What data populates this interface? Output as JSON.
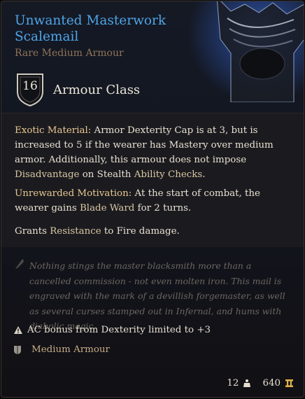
{
  "item": {
    "name": "Unwanted Masterwork Scalemail",
    "rarity_type": "Rare Medium Armour",
    "armour_class": "16",
    "armour_class_label": "Armour Class"
  },
  "effects": {
    "exotic_title": "Exotic Material:",
    "exotic_text_1": " Armor Dexterity Cap is at 3, but is increased to 5 if the wearer has Mastery over medium armor. Additionally, this armour does not impose ",
    "exotic_kw_disadvantage": "Disadvantage",
    "exotic_text_2": " on Stealth ",
    "exotic_kw_ability_checks": "Ability Checks",
    "exotic_text_3": ".",
    "motivation_title": "Unrewarded Motivation:",
    "motivation_text_1": " At the start of combat, the wearer gains ",
    "motivation_kw": "Blade Ward",
    "motivation_text_2": " for 2 turns.",
    "grants_text_1": "Grants ",
    "grants_kw": "Resistance",
    "grants_text_2": " to Fire damage."
  },
  "flavor_text": "Nothing stings the master blacksmith more than a cancelled commission - not even molten iron. This mail is engraved with the mark of a devillish forgemaster, as well as several curses stamped out in Infernal, and hums with diabolic magic.",
  "notes": {
    "dex_limit": "AC bonus from Dexterity limited to +3",
    "armour_type": "Medium Armour"
  },
  "footer": {
    "weight": "12",
    "price": "640"
  },
  "icons": [
    "shield-icon",
    "quill-icon",
    "warning-icon",
    "armour-type-icon",
    "weight-icon",
    "gold-icon"
  ],
  "colors": {
    "title": "#4ea5e8",
    "subtitle": "#8e7458",
    "keyword": "#e8c892"
  }
}
